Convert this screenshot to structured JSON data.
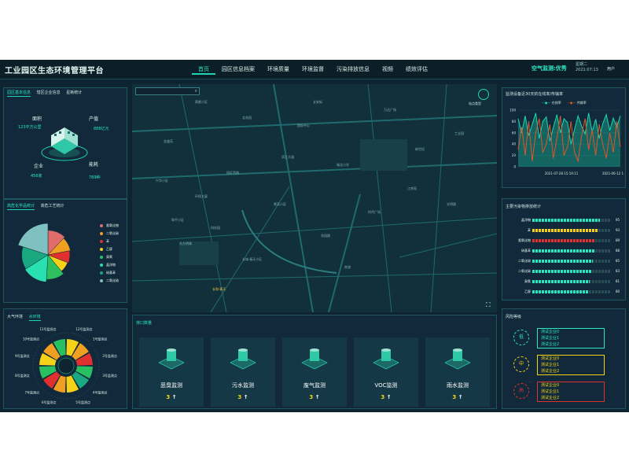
{
  "header": {
    "title": "工业园区生态环境管理平台",
    "nav": [
      "首页",
      "园区信息档案",
      "环境质量",
      "环境监督",
      "污染排放信息",
      "视频",
      "绩效评估"
    ],
    "air_quality": "空气监测:优秀",
    "weekday": "星期二",
    "date": "2021:07:13",
    "user": "用户"
  },
  "park_info": {
    "tabs": [
      "园区基本信息",
      "辖区企业信息",
      "星耗统计"
    ],
    "area_label": "面积",
    "area_value": "123平方公里",
    "output_label": "产值",
    "output_value": "888亿元",
    "company_label": "企业",
    "company_value": "456家",
    "energy_label": "能耗",
    "energy_value": "789种"
  },
  "chem_stats": {
    "tabs": [
      "高危化学品统计",
      "高危工艺统计"
    ],
    "legend": [
      "氯氧化物",
      "二氧化碳",
      "苯",
      "乙醇",
      "臭氧",
      "晶淨物",
      "硝基苯",
      "二氧化硫"
    ],
    "colors": [
      "#e06c6c",
      "#f0a020",
      "#e03030",
      "#f5d218",
      "#2ec060",
      "#28e0b0",
      "#1aa880",
      "#7fc0c0"
    ]
  },
  "env_monitor": {
    "tabs": [
      "大气环境",
      "水环境"
    ],
    "points": [
      "12号监测点",
      "1号监测点",
      "2号监测点",
      "3号监测点",
      "4号监测点",
      "5号监测点",
      "6号监测点",
      "7号监测点",
      "8号监测点",
      "9号监测点",
      "10号监测点",
      "11号监测点"
    ]
  },
  "map": {
    "search_placeholder": "",
    "station_type_label": "站点类型",
    "labels": [
      "长和·春天",
      "燕都小区",
      "北花园",
      "金盛苑",
      "国际中心",
      "万达广场",
      "新世纪",
      "园区西路",
      "环保大厦",
      "城北小学",
      "江南苑",
      "科技园",
      "东方明珠",
      "长城·春天小区",
      "花园路",
      "时代广场",
      "滨江大道",
      "兴华小区",
      "工业园",
      "南湖",
      "景苑小区",
      "长安街",
      "光明路",
      "和平小区"
    ]
  },
  "pollution_count": {
    "title": "排口数量",
    "cards": [
      {
        "name": "恶臭监测",
        "count": "3"
      },
      {
        "name": "污水监测",
        "count": "3"
      },
      {
        "name": "废气监测",
        "count": "3"
      },
      {
        "name": "VOC监测",
        "count": "3"
      },
      {
        "name": "雨水监测",
        "count": "3"
      }
    ],
    "arrow": "↑"
  },
  "online_rate": {
    "title": "监测设备近30天的在线率/传输率",
    "legend": [
      "在线率",
      "传输率"
    ],
    "y_ticks": [
      "100",
      "80",
      "60",
      "40",
      "20",
      "0"
    ],
    "x_ticks": [
      "2021-07-28 15:19:11",
      "2021-06-12 1"
    ]
  },
  "emission_stats": {
    "title": "主要污染物排放统计",
    "rows": [
      {
        "name": "晶淨物",
        "value": 95
      },
      {
        "name": "苯",
        "value": 93
      },
      {
        "name": "氯氧化物",
        "value": 89
      },
      {
        "name": "硝基苯",
        "value": 88
      },
      {
        "name": "二氧化硫",
        "value": 85
      },
      {
        "name": "二氧化碳",
        "value": 83
      },
      {
        "name": "臭氧",
        "value": 81
      },
      {
        "name": "乙醇",
        "value": 80
      }
    ]
  },
  "risk_level": {
    "title": "风险等级",
    "levels": [
      {
        "level": "低",
        "color": "#29e7c0",
        "companies": [
          "测试企业0",
          "测试企业1",
          "测试企业2"
        ]
      },
      {
        "level": "中",
        "color": "#f5d218",
        "companies": [
          "测试企业0",
          "测试企业1",
          "测试企业2"
        ]
      },
      {
        "level": "高",
        "color": "#e03030",
        "companies": [
          "测试企业0",
          "测试企业1",
          "测试企业2"
        ]
      }
    ]
  },
  "chart_data": [
    {
      "type": "line",
      "title": "监测设备近30天的在线率/传输率",
      "ylim": [
        0,
        100
      ],
      "x": [
        "2021-07-28 15:19:11",
        "2021-06-12 1"
      ],
      "series": [
        {
          "name": "在线率",
          "values": [
            85,
            60,
            90,
            55,
            75,
            95,
            50,
            80,
            88,
            45,
            70,
            92,
            60,
            85,
            78,
            40,
            66,
            90,
            72,
            58,
            95,
            62,
            84,
            50,
            76,
            92,
            64,
            86,
            70,
            90
          ]
        },
        {
          "name": "传输率",
          "values": [
            30,
            70,
            20,
            80,
            10,
            60,
            85,
            25,
            40,
            75,
            15,
            50,
            90,
            20,
            35,
            80,
            25,
            10,
            55,
            85,
            30,
            65,
            20,
            75,
            40,
            15,
            60,
            25,
            80,
            35
          ]
        }
      ]
    },
    {
      "type": "bar",
      "title": "主要污染物排放统计",
      "categories": [
        "晶淨物",
        "苯",
        "氯氧化物",
        "硝基苯",
        "二氧化硫",
        "二氧化碳",
        "臭氧",
        "乙醇"
      ],
      "values": [
        95,
        93,
        89,
        88,
        85,
        83,
        81,
        80
      ],
      "ylim": [
        0,
        100
      ]
    },
    {
      "type": "pie",
      "title": "高危化学品统计",
      "categories": [
        "氯氧化物",
        "二氧化碳",
        "苯",
        "乙醇",
        "臭氧",
        "晶淨物",
        "硝基苯",
        "二氧化硫"
      ],
      "values": [
        12,
        10,
        9,
        8,
        12,
        15,
        14,
        20
      ]
    }
  ]
}
